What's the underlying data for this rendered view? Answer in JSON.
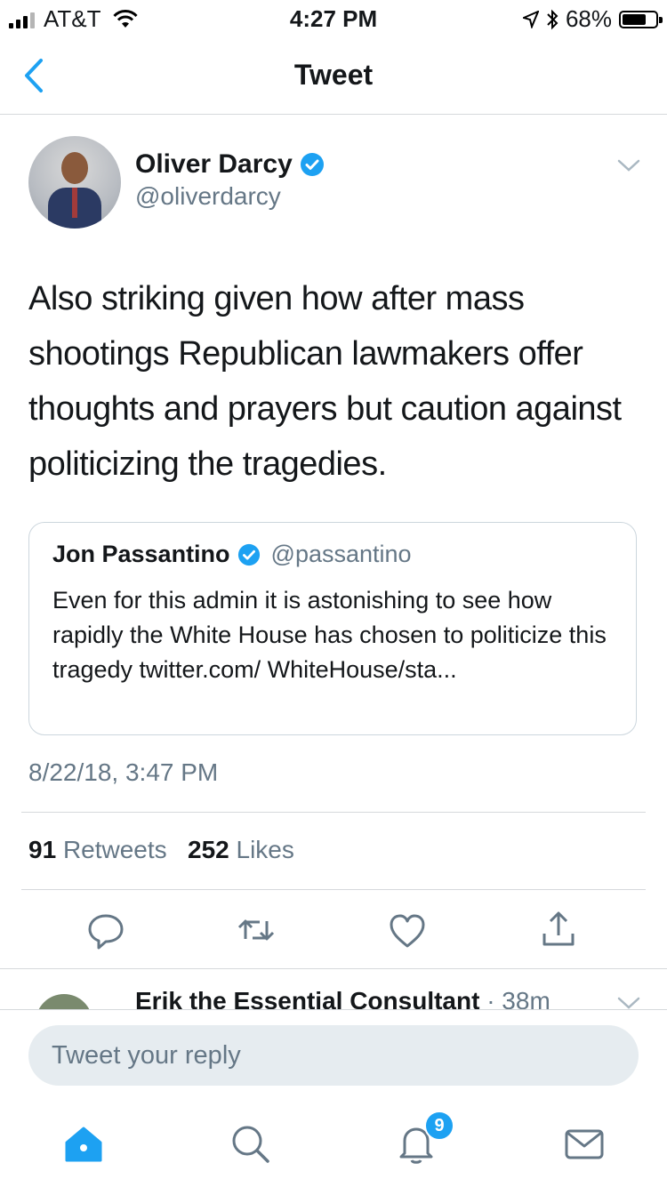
{
  "status_bar": {
    "carrier": "AT&T",
    "time": "4:27 PM",
    "battery": "68%",
    "battery_level": 0.68
  },
  "nav": {
    "title": "Tweet",
    "back_icon": "chevron-left-icon"
  },
  "tweet": {
    "author_name": "Oliver Darcy",
    "author_handle": "@oliverdarcy",
    "verified": true,
    "text": "Also striking given how after mass shootings Republican lawmakers offer thoughts and prayers but caution against politicizing the tragedies.",
    "quoted": {
      "name": "Jon Passantino",
      "handle": "@passantino",
      "verified": true,
      "text": "Even for this admin it is astonishing to see how rapidly the White House has chosen to politicize this tragedy twitter.com/ WhiteHouse/sta..."
    },
    "timestamp": "8/22/18, 3:47 PM",
    "retweets_count": "91",
    "retweets_label": "Retweets",
    "likes_count": "252",
    "likes_label": "Likes"
  },
  "actions": [
    "reply-icon",
    "retweet-icon",
    "like-icon",
    "share-icon"
  ],
  "reply_preview": {
    "name": "Erik the Essential Consultant",
    "meta": "· 38m"
  },
  "reply_box": {
    "placeholder": "Tweet your reply"
  },
  "tab_bar": {
    "items": [
      "home-icon",
      "search-icon",
      "notifications-icon",
      "messages-icon"
    ],
    "notification_badge": "9"
  },
  "colors": {
    "accent": "#1da1f2",
    "secondary_text": "#657786",
    "divider": "#d6d9dc"
  }
}
